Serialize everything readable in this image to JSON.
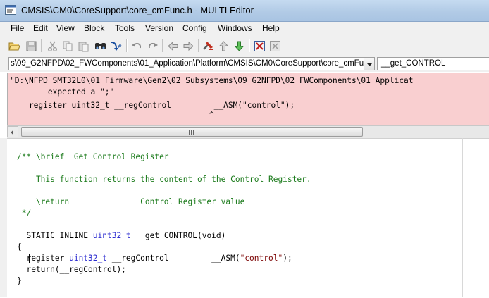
{
  "window": {
    "title": "CMSIS\\CM0\\CoreSupport\\core_cmFunc.h - MULTI Editor"
  },
  "menu": [
    {
      "label": "File",
      "u": "F",
      "rest": "ile"
    },
    {
      "label": "Edit",
      "u": "E",
      "rest": "dit"
    },
    {
      "label": "View",
      "u": "V",
      "rest": "iew"
    },
    {
      "label": "Block",
      "u": "B",
      "rest": "lock"
    },
    {
      "label": "Tools",
      "u": "T",
      "rest": "ools"
    },
    {
      "label": "Version",
      "u": "V",
      "rest": "ersion"
    },
    {
      "label": "Config",
      "u": "C",
      "rest": "onfig"
    },
    {
      "label": "Windows",
      "u": "W",
      "rest": "indows"
    },
    {
      "label": "Help",
      "u": "H",
      "rest": "elp"
    }
  ],
  "toolbar_icons": [
    "open-folder-icon",
    "save-icon",
    "cut-icon",
    "copy-icon",
    "paste-icon",
    "find-icon",
    "goto-definition-icon",
    "undo-icon",
    "redo-icon",
    "back-arrow-icon",
    "forward-arrow-icon",
    "build-icon",
    "up-arrow-icon",
    "down-arrow-icon",
    "close-file-icon",
    "close-all-icon"
  ],
  "pathbar": {
    "file_path": "s\\09_G2NFPD\\02_FWComponents\\01_Application\\Platform\\CMSIS\\CM0\\CoreSupport\\core_cmFunc.h",
    "function": "__get_CONTROL"
  },
  "error": {
    "line1": "\"D:\\NFPD SMT32L0\\01_Firmware\\Gen2\\02_Subsystems\\09_G2NFPD\\02_FWComponents\\01_Applicat",
    "line2": "        expected a \";\"",
    "line3": "    register uint32_t __regControl         __ASM(\"control\");",
    "line4": "                                          ^"
  },
  "code": {
    "l1": "/** \\brief  Get Control Register",
    "l2": "    This function returns the content of the Control Register.",
    "l3": "    \\return               Control Register value",
    "l4": " */",
    "l5_a": "__STATIC_INLINE ",
    "l5_b": "uint32_t",
    "l5_c": " __get_CONTROL(void)",
    "l6": "{",
    "l7_a": "  register ",
    "l7_b": "uint32_t",
    "l7_c": " __regControl         __ASM(",
    "l7_d": "\"control\"",
    "l7_e": ");",
    "l8": "  return(__regControl);",
    "l9": "}"
  },
  "colors": {
    "comment": "#1a7a1a",
    "keyword": "#2a2ad0",
    "string": "#7a0000",
    "error_bg": "#f9cfd0"
  }
}
